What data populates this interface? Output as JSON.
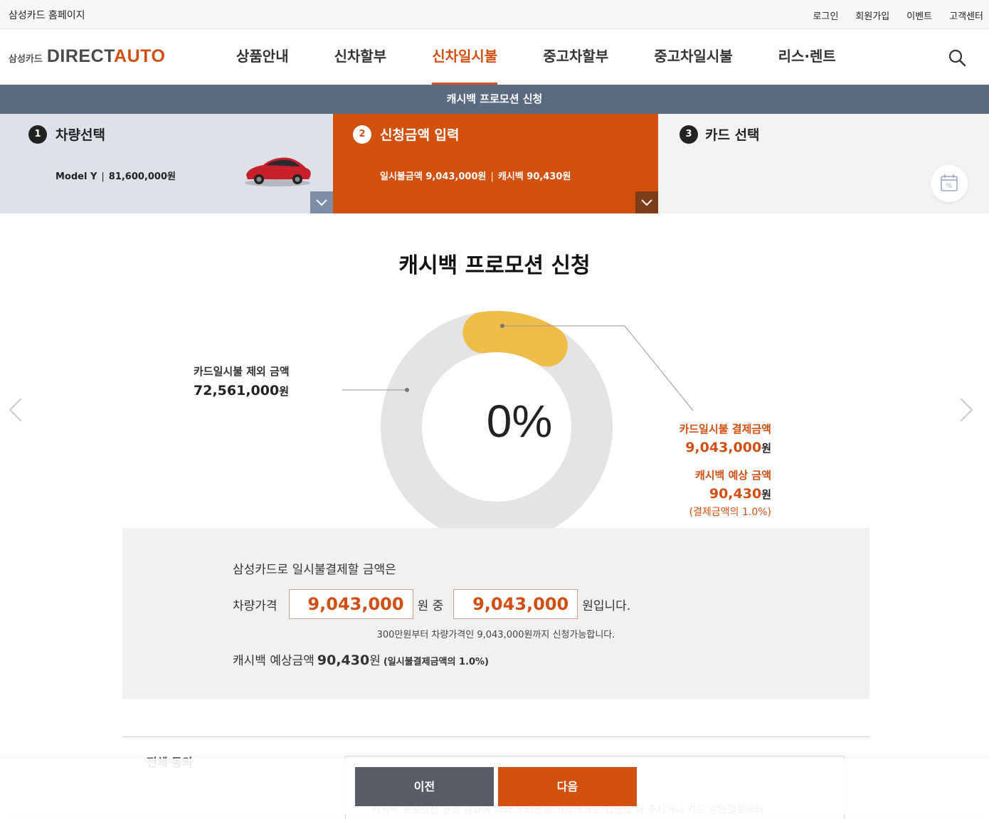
{
  "util": {
    "home": "삼성카드 홈페이지",
    "links": [
      "로그인",
      "회원가입",
      "이벤트",
      "고객센터"
    ]
  },
  "logo": {
    "prefix": "삼성카드",
    "name_main": "DIRECT",
    "name_accent": "AUTO"
  },
  "nav": {
    "items": [
      "상품안내",
      "신차할부",
      "신차일시불",
      "중고차할부",
      "중고차일시불",
      "리스·렌트"
    ],
    "active_index": 2
  },
  "subbar": {
    "title": "캐시백 프로모션 신청"
  },
  "steps": [
    {
      "num": "1",
      "title": "차량선택",
      "model": "Model Y",
      "price": "81,600,000원"
    },
    {
      "num": "2",
      "title": "신청금액 입력",
      "amount": "일시불금액 9,043,000원",
      "cashback": "캐시백 90,430원"
    },
    {
      "num": "3",
      "title": "카드 선택"
    }
  ],
  "main": {
    "heading": "캐시백 프로모션 신청",
    "donut_percent": "0%",
    "paid_fraction": 0.111,
    "excluded": {
      "label": "카드일시불 제외 금액",
      "value": "72,561,000",
      "unit": "원"
    },
    "paid": {
      "label": "카드일시불 결제금액",
      "value": "9,043,000",
      "unit": "원"
    },
    "expected": {
      "label": "캐시백 예상 금액",
      "value": "90,430",
      "unit": "원",
      "note": "(결제금액의 1.0%)"
    }
  },
  "panel": {
    "intro": "삼성카드로 일시불결제할 금액은",
    "car_price_label": "차량가격",
    "car_price_value": "9,043,000",
    "mid_text": "원 중",
    "pay_value": "9,043,000",
    "end_text": "원입니다.",
    "hint": "300만원부터 차량가격인 9,043,000원까지 신청가능합니다.",
    "cashback_label": "캐시백 예상금액",
    "cashback_value": "90,430",
    "cashback_unit": "원",
    "cashback_pct": "(일시불결제금액의 1.0%)"
  },
  "agree": {
    "all_label": "전체 동의",
    "notice": "캐시백 프로모션 신청 결과에 따라 우리은행 가상계좌로 입금을 해 주시거나 카드 승인일로부터"
  },
  "buttons": {
    "prev": "이전",
    "next": "다음"
  },
  "colors": {
    "accent": "#d2510f",
    "subbar": "#5a6a80",
    "donut_track": "#e4e4e4",
    "donut_seg": "#f0bc48"
  }
}
